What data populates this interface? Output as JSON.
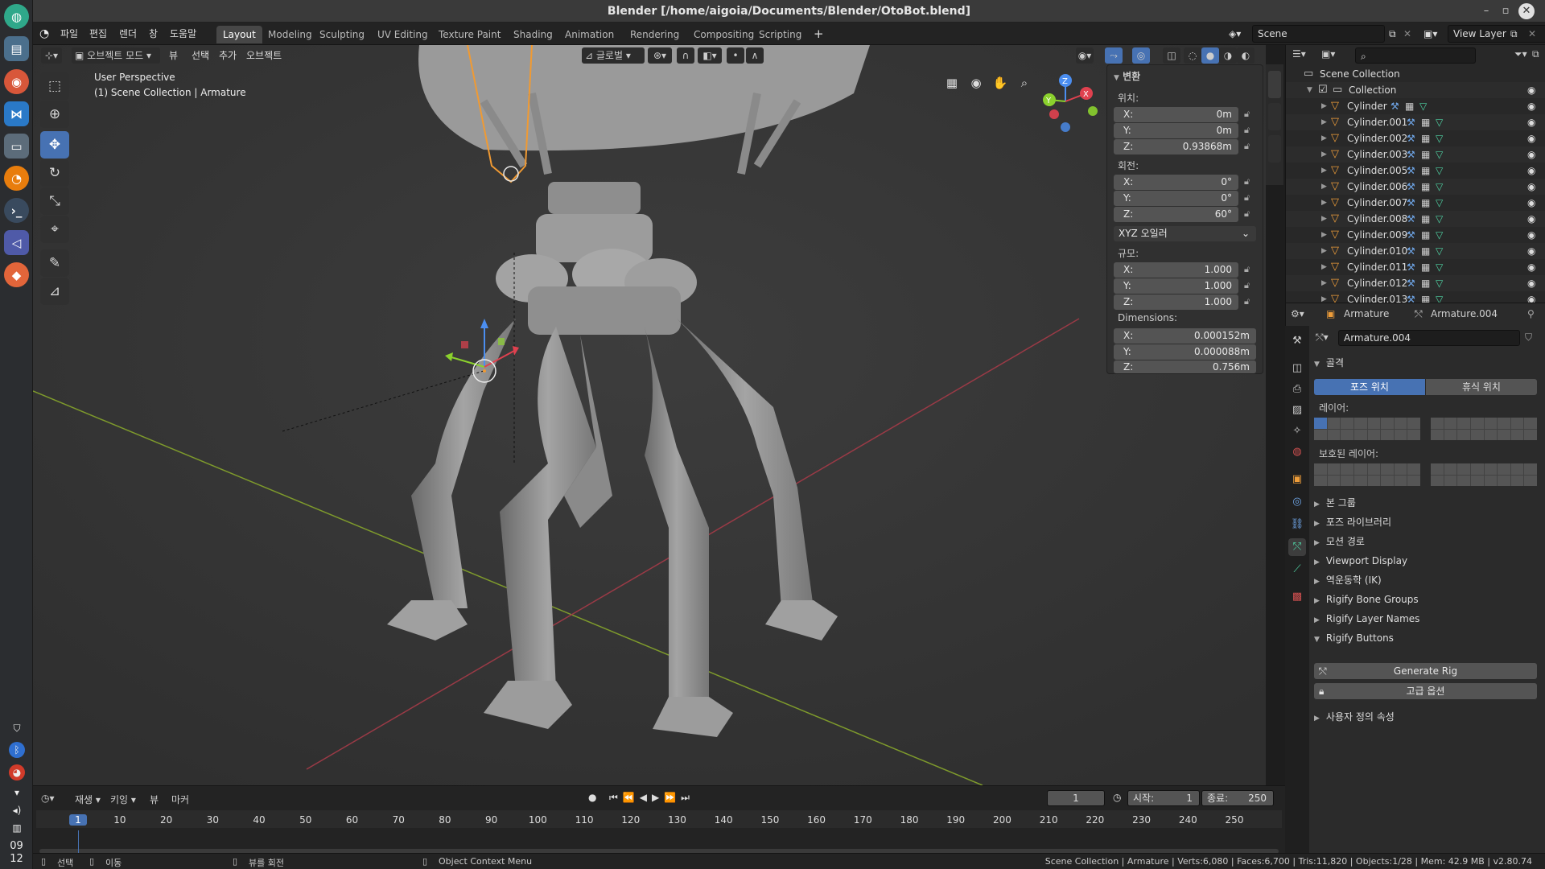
{
  "window": {
    "title": "Blender [/home/aigoia/Documents/Blender/OtoBot.blend]"
  },
  "clock": {
    "hour": "09",
    "minute": "12"
  },
  "menu": [
    "파일",
    "편집",
    "렌더",
    "창",
    "도움말"
  ],
  "workspaces": [
    "Layout",
    "Modeling",
    "Sculpting",
    "UV Editing",
    "Texture Paint",
    "Shading",
    "Animation",
    "Rendering",
    "Compositing",
    "Scripting"
  ],
  "scene": {
    "name": "Scene",
    "view_layer": "View Layer"
  },
  "viewport_header": {
    "mode": "오브젝트 모드",
    "view": "뷰",
    "select": "선택",
    "add": "추가",
    "object": "오브젝트",
    "orientation": "글로벌"
  },
  "viewport": {
    "perspective": "User Perspective",
    "context": "(1) Scene Collection | Armature"
  },
  "gizmo_axes": {
    "x": "X",
    "y": "Y",
    "z": "Z"
  },
  "npanel": {
    "header": "변환",
    "location_label": "위치:",
    "location": [
      {
        "k": "X:",
        "v": "0m"
      },
      {
        "k": "Y:",
        "v": "0m"
      },
      {
        "k": "Z:",
        "v": "0.93868m"
      }
    ],
    "rotation_label": "회전:",
    "rotation": [
      {
        "k": "X:",
        "v": "0°"
      },
      {
        "k": "Y:",
        "v": "0°"
      },
      {
        "k": "Z:",
        "v": "60°"
      }
    ],
    "rotation_mode": "XYZ 오일러",
    "scale_label": "규모:",
    "scale": [
      {
        "k": "X:",
        "v": "1.000"
      },
      {
        "k": "Y:",
        "v": "1.000"
      },
      {
        "k": "Z:",
        "v": "1.000"
      }
    ],
    "dimensions_label": "Dimensions:",
    "dimensions": [
      {
        "k": "X:",
        "v": "0.000152m"
      },
      {
        "k": "Y:",
        "v": "0.000088m"
      },
      {
        "k": "Z:",
        "v": "0.756m"
      }
    ]
  },
  "outliner": {
    "root": "Scene Collection",
    "collection": "Collection",
    "items": [
      "Cylinder",
      "Cylinder.001",
      "Cylinder.002",
      "Cylinder.003",
      "Cylinder.005",
      "Cylinder.006",
      "Cylinder.007",
      "Cylinder.008",
      "Cylinder.009",
      "Cylinder.010",
      "Cylinder.011",
      "Cylinder.012",
      "Cylinder.013"
    ]
  },
  "properties": {
    "object": "Armature",
    "data": "Armature.004",
    "datablock": "Armature.004",
    "skeleton": "골격",
    "pose_position": "포즈 위치",
    "rest_position": "휴식 위치",
    "layers": "레이어:",
    "protected_layers": "보호된 레이어:",
    "panels": [
      "본 그룹",
      "포즈 라이브러리",
      "모션 경로",
      "Viewport Display",
      "역운동학 (IK)",
      "Rigify Bone Groups",
      "Rigify Layer Names"
    ],
    "rigify_buttons": "Rigify Buttons",
    "generate_rig": "Generate Rig",
    "advanced": "고급 옵션",
    "custom_props": "사용자 정의 속성"
  },
  "timeline": {
    "menus": [
      "재생",
      "키잉",
      "뷰",
      "마커"
    ],
    "current_frame": "1",
    "start_label": "시작:",
    "start": "1",
    "end_label": "종료:",
    "end": "250",
    "ticks": [
      "1",
      "10",
      "20",
      "30",
      "40",
      "50",
      "60",
      "70",
      "80",
      "90",
      "100",
      "110",
      "120",
      "130",
      "140",
      "150",
      "160",
      "170",
      "180",
      "190",
      "200",
      "210",
      "220",
      "230",
      "240",
      "250"
    ]
  },
  "statusbar": {
    "select": "선택",
    "move": "이동",
    "rotate_view": "뷰를 회전",
    "context_menu": "Object Context Menu",
    "stats": "Scene Collection | Armature | Verts:6,080 | Faces:6,700 | Tris:11,820 | Objects:1/28 | Mem: 42.9 MB | v2.80.74"
  },
  "colors": {
    "accent": "#4772b3",
    "object_orange": "#ee9d3a",
    "x_axis": "#e0414f",
    "y_axis": "#8bd12d",
    "z_axis": "#4b8ef0"
  }
}
